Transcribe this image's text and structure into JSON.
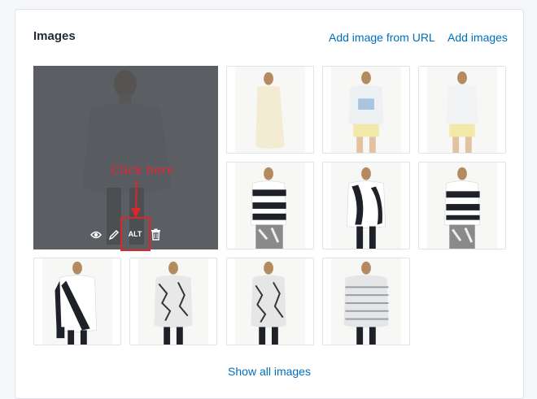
{
  "section": {
    "title": "Images",
    "add_from_url_label": "Add image from URL",
    "add_images_label": "Add images",
    "show_all_label": "Show all images"
  },
  "featured_overlay": {
    "alt_label": "ALT",
    "icons": [
      "eye-icon",
      "pencil-icon",
      "trash-icon"
    ]
  },
  "annotation": {
    "text": "Click here",
    "color": "#e0242c"
  },
  "colors": {
    "link": "#006fbb",
    "title": "#212b36",
    "border": "#dfe3e8"
  },
  "thumbnails": [
    {
      "desc": "cream tunic top, back view"
    },
    {
      "desc": "white tee with blue print, yellow shorts"
    },
    {
      "desc": "white tee, yellow shorts, back view"
    },
    {
      "desc": "black and white striped sweater, printed pants"
    },
    {
      "desc": "black and white graphic sweater, black pants"
    },
    {
      "desc": "black and white striped sweater, back view"
    },
    {
      "desc": "black and white graphic top, back view"
    },
    {
      "desc": "black and white print top, front view"
    },
    {
      "desc": "black and white print top, back view"
    },
    {
      "desc": "grey striped long sleeve top"
    }
  ]
}
